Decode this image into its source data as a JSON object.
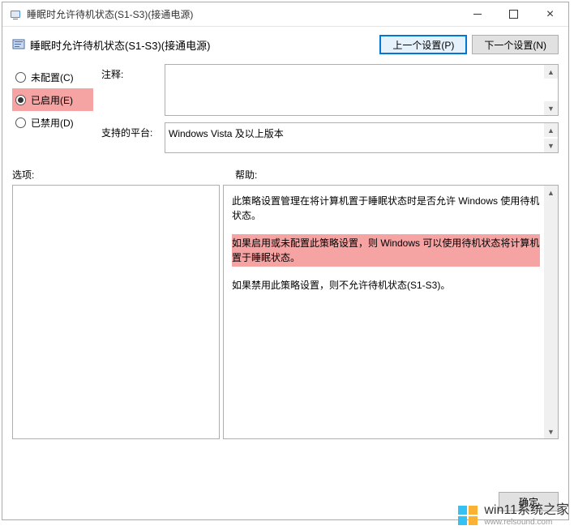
{
  "window": {
    "title": "睡眠时允许待机状态(S1-S3)(接通电源)"
  },
  "subheader": {
    "title": "睡眠时允许待机状态(S1-S3)(接通电源)"
  },
  "nav": {
    "prev": "上一个设置(P)",
    "next": "下一个设置(N)"
  },
  "radios": {
    "not_configured": "未配置(C)",
    "enabled": "已启用(E)",
    "disabled": "已禁用(D)"
  },
  "labels": {
    "comment": "注释:",
    "platform": "支持的平台:",
    "options": "选项:",
    "help": "帮助:"
  },
  "fields": {
    "comment": "",
    "platform": "Windows Vista 及以上版本"
  },
  "help": {
    "p1": "此策略设置管理在将计算机置于睡眠状态时是否允许 Windows 使用待机状态。",
    "p2": "如果启用或未配置此策略设置，则 Windows 可以使用待机状态将计算机置于睡眠状态。",
    "p3": "如果禁用此策略设置，则不允许待机状态(S1-S3)。"
  },
  "footer": {
    "ok": "确定"
  },
  "watermark": {
    "main": "win11系统之家",
    "sub": "www.relsound.com"
  }
}
